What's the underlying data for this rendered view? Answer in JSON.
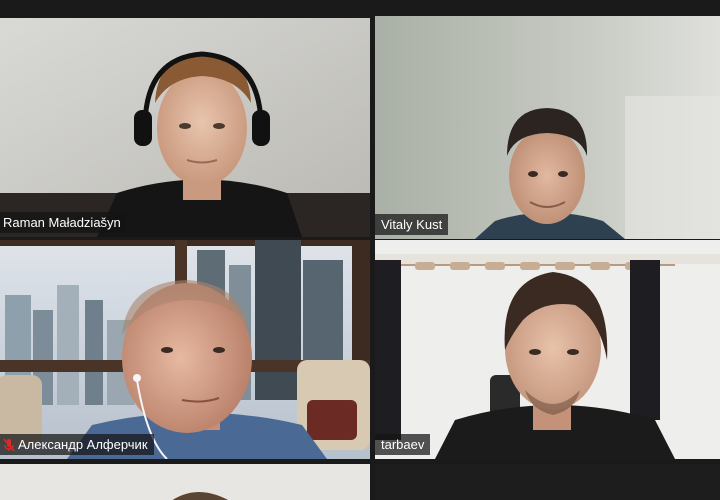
{
  "meeting": {
    "layout": "gallery",
    "active_speaker_color": "#c6e35a"
  },
  "participants": [
    {
      "name": "Raman Maładziašyn",
      "muted": false,
      "active_speaker": false
    },
    {
      "name": "Vitaly Kust",
      "muted": false,
      "active_speaker": true
    },
    {
      "name": "Александр Алферчик",
      "muted": true,
      "active_speaker": false
    },
    {
      "name": "tarbaev",
      "muted": false,
      "active_speaker": false
    }
  ],
  "icons": {
    "muted": "mic-muted-icon"
  }
}
